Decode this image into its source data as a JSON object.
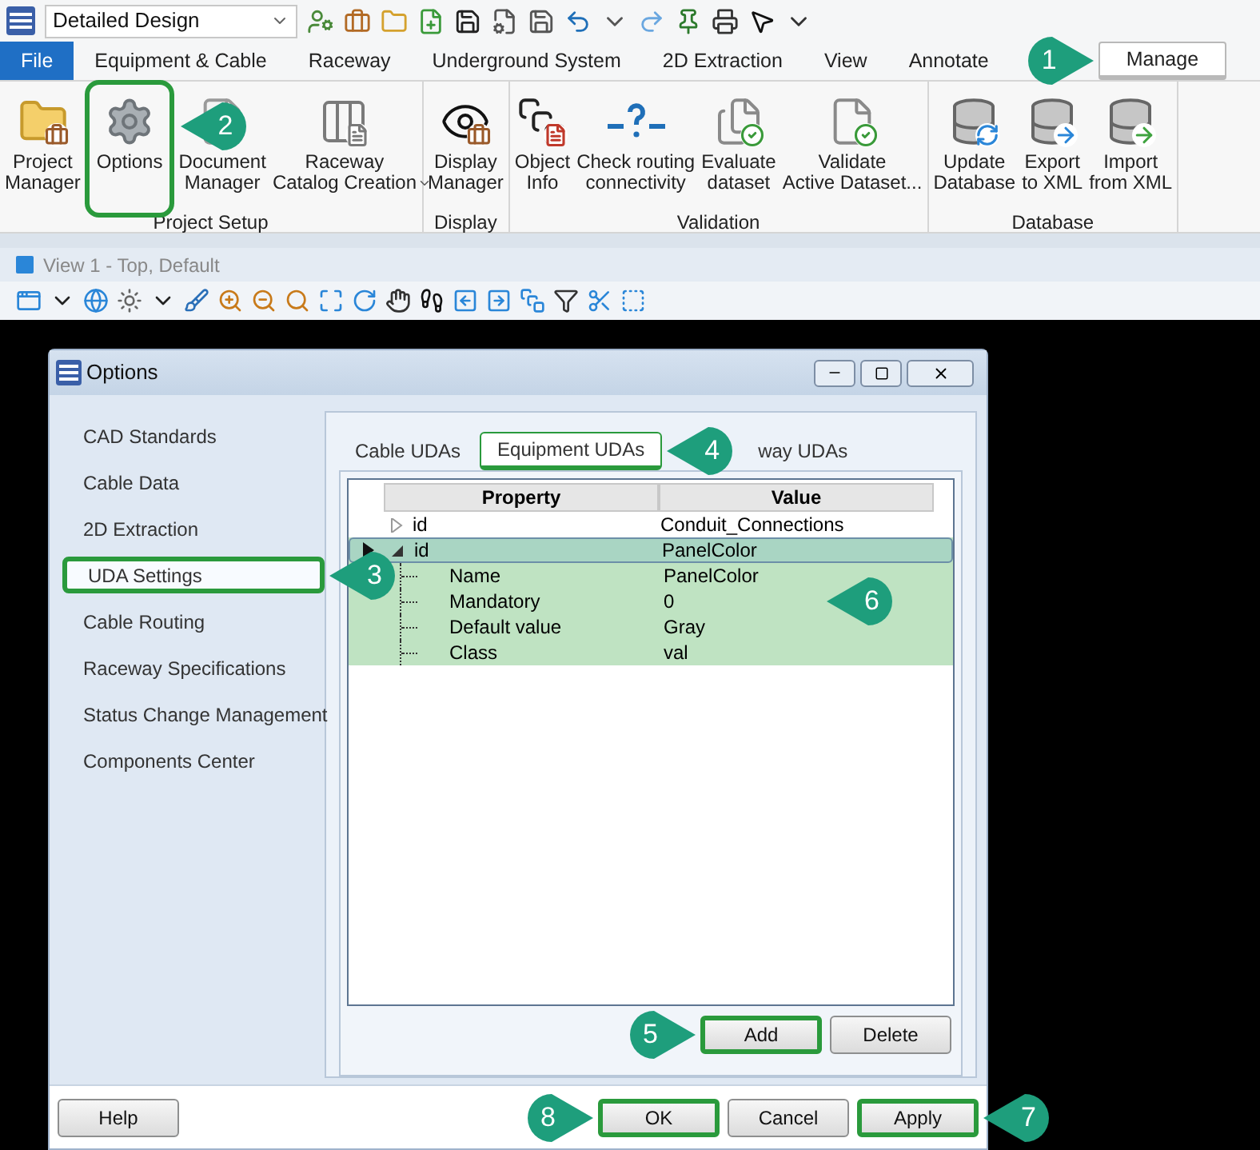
{
  "quick_access": {
    "workflow": "Detailed Design"
  },
  "ribbon_tabs": [
    {
      "label": "File",
      "kind": "file",
      "selected": false,
      "highlighted": false
    },
    {
      "label": "Equipment & Cable",
      "kind": "tab",
      "selected": false,
      "highlighted": false
    },
    {
      "label": "Raceway",
      "kind": "tab",
      "selected": false,
      "highlighted": false
    },
    {
      "label": "Underground System",
      "kind": "tab",
      "selected": false,
      "highlighted": false
    },
    {
      "label": "2D Extraction",
      "kind": "tab",
      "selected": false,
      "highlighted": false
    },
    {
      "label": "View",
      "kind": "tab",
      "selected": false,
      "highlighted": false
    },
    {
      "label": "Annotate",
      "kind": "tab",
      "selected": false,
      "highlighted": false
    },
    {
      "label": "Manage",
      "kind": "tab",
      "selected": true,
      "highlighted": true,
      "callout": {
        "label": "1",
        "points_right": true
      }
    }
  ],
  "ribbon_groups": [
    {
      "label": "Project Setup",
      "buttons": [
        {
          "lines": [
            "Project",
            "Manager"
          ],
          "highlighted": false
        },
        {
          "lines": [
            "Options"
          ],
          "highlighted": true,
          "callout": {
            "label": "2",
            "points_right": false
          }
        },
        {
          "lines": [
            "Document",
            "Manager"
          ],
          "highlighted": false
        },
        {
          "lines": [
            "Raceway",
            "Catalog Creation"
          ],
          "highlighted": false,
          "dropdown": true
        }
      ]
    },
    {
      "label": "Display",
      "buttons": [
        {
          "lines": [
            "Display",
            "Manager"
          ],
          "highlighted": false
        }
      ]
    },
    {
      "label": "Validation",
      "buttons": [
        {
          "lines": [
            "Object",
            "Info"
          ],
          "highlighted": false
        },
        {
          "lines": [
            "Check routing",
            "connectivity"
          ],
          "highlighted": false
        },
        {
          "lines": [
            "Evaluate",
            "dataset"
          ],
          "highlighted": false
        },
        {
          "lines": [
            "Validate",
            "Active Dataset..."
          ],
          "highlighted": false
        }
      ]
    },
    {
      "label": "Database",
      "buttons": [
        {
          "lines": [
            "Update",
            "Database"
          ],
          "highlighted": false
        },
        {
          "lines": [
            "Export",
            "to XML"
          ],
          "highlighted": false
        },
        {
          "lines": [
            "Import",
            "from XML"
          ],
          "highlighted": false
        }
      ]
    }
  ],
  "view_window": {
    "title": "View 1 - Top, Default"
  },
  "dialog": {
    "title": "Options",
    "nav_items": [
      {
        "label": "CAD Standards",
        "selected": false,
        "highlighted": false
      },
      {
        "label": "Cable Data",
        "selected": false,
        "highlighted": false
      },
      {
        "label": "2D Extraction",
        "selected": false,
        "highlighted": false
      },
      {
        "label": "UDA Settings",
        "selected": true,
        "highlighted": true,
        "callout": {
          "label": "3",
          "points_right": false
        }
      },
      {
        "label": "Cable Routing",
        "selected": false,
        "highlighted": false
      },
      {
        "label": "Raceway Specifications",
        "selected": false,
        "highlighted": false
      },
      {
        "label": "Status Change Management",
        "selected": false,
        "highlighted": false
      },
      {
        "label": "Components Center",
        "selected": false,
        "highlighted": false
      }
    ],
    "tabs": [
      {
        "label": "Cable UDAs",
        "selected": false,
        "highlighted": false
      },
      {
        "label": "Equipment UDAs",
        "selected": true,
        "highlighted": true,
        "callout": {
          "label": "4",
          "points_right": false
        }
      },
      {
        "label": "way UDAs",
        "selected": false,
        "highlighted": false
      }
    ],
    "grid": {
      "columns": [
        "Property",
        "Value"
      ],
      "rows": [
        {
          "property": "id",
          "value": "Conduit_Connections",
          "expanded": false,
          "current": false,
          "highlighted": false,
          "children": []
        },
        {
          "property": "id",
          "value": "PanelColor",
          "expanded": true,
          "current": true,
          "highlighted": true,
          "callout": {
            "label": "6",
            "points_right": false
          },
          "children": [
            {
              "property": "Name",
              "value": "PanelColor"
            },
            {
              "property": "Mandatory",
              "value": "0"
            },
            {
              "property": "Default value",
              "value": "Gray"
            },
            {
              "property": "Class",
              "value": "val"
            }
          ]
        }
      ]
    },
    "grid_buttons": [
      {
        "label": "Add",
        "highlighted": true,
        "callout": {
          "label": "5",
          "points_right": true
        }
      },
      {
        "label": "Delete",
        "highlighted": false
      }
    ],
    "footer_buttons": [
      {
        "label": "Help",
        "kind": "help",
        "highlighted": false
      },
      {
        "label": "OK",
        "kind": "action",
        "highlighted": true,
        "callout": {
          "label": "8",
          "points_right": true
        }
      },
      {
        "label": "Cancel",
        "kind": "action",
        "highlighted": false
      },
      {
        "label": "Apply",
        "kind": "action",
        "highlighted": true,
        "callout": {
          "label": "7",
          "points_right": false
        }
      }
    ]
  }
}
